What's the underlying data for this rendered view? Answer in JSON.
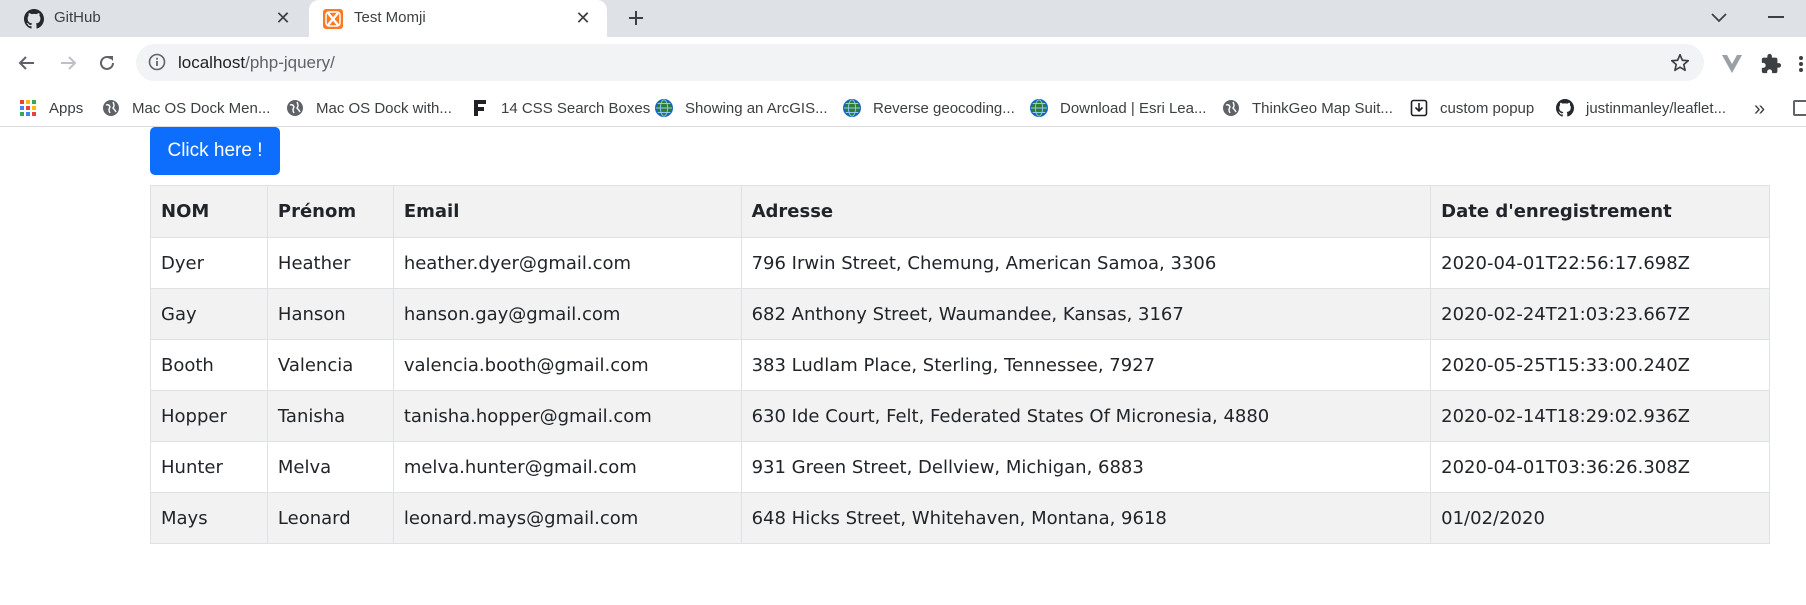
{
  "browser": {
    "tabs": [
      {
        "title": "GitHub",
        "icon": "github-icon",
        "active": false
      },
      {
        "title": "Test Momji",
        "icon": "xampp-icon",
        "active": true
      }
    ],
    "address": {
      "host": "localhost",
      "path": "/php-jquery/"
    },
    "bookmarks": [
      {
        "label": "Apps",
        "icon": "apps-grid-icon"
      },
      {
        "label": "Mac OS Dock Men...",
        "icon": "globe-icon"
      },
      {
        "label": "Mac OS Dock with...",
        "icon": "globe-icon"
      },
      {
        "label": "14 CSS Search Boxes",
        "icon": "freefrontend-icon"
      },
      {
        "label": "Showing an ArcGIS...",
        "icon": "arcgis-globe-icon"
      },
      {
        "label": "Reverse geocoding...",
        "icon": "arcgis-globe-icon"
      },
      {
        "label": "Download | Esri Lea...",
        "icon": "arcgis-globe-icon"
      },
      {
        "label": "ThinkGeo Map Suit...",
        "icon": "globe-icon"
      },
      {
        "label": "custom popup",
        "icon": "download-box-icon"
      },
      {
        "label": "justinmanley/leaflet...",
        "icon": "github-icon"
      }
    ],
    "bookmarks_overflow": "»"
  },
  "page": {
    "button_label": "Click here !",
    "table": {
      "headers": [
        "NOM",
        "Prénom",
        "Email",
        "Adresse",
        "Date d'enregistrement"
      ],
      "rows": [
        [
          "Dyer",
          "Heather",
          "heather.dyer@gmail.com",
          "796 Irwin Street, Chemung, American Samoa, 3306",
          "2020-04-01T22:56:17.698Z"
        ],
        [
          "Gay",
          "Hanson",
          "hanson.gay@gmail.com",
          "682 Anthony Street, Waumandee, Kansas, 3167",
          "2020-02-24T21:03:23.667Z"
        ],
        [
          "Booth",
          "Valencia",
          "valencia.booth@gmail.com",
          "383 Ludlam Place, Sterling, Tennessee, 7927",
          "2020-05-25T15:33:00.240Z"
        ],
        [
          "Hopper",
          "Tanisha",
          "tanisha.hopper@gmail.com",
          "630 Ide Court, Felt, Federated States Of Micronesia, 4880",
          "2020-02-14T18:29:02.936Z"
        ],
        [
          "Hunter",
          "Melva",
          "melva.hunter@gmail.com",
          "931 Green Street, Dellview, Michigan, 6883",
          "2020-04-01T03:36:26.308Z"
        ],
        [
          "Mays",
          "Leonard",
          "leonard.mays@gmail.com",
          "648 Hicks Street, Whitehaven, Montana, 9618",
          "01/02/2020"
        ]
      ]
    }
  },
  "colors": {
    "button_bg": "#0d6efd",
    "tabstrip_bg": "#dee1e6",
    "omnibox_bg": "#f1f3f4",
    "table_stripe": "#f2f2f2",
    "table_border": "#dee2e6"
  }
}
